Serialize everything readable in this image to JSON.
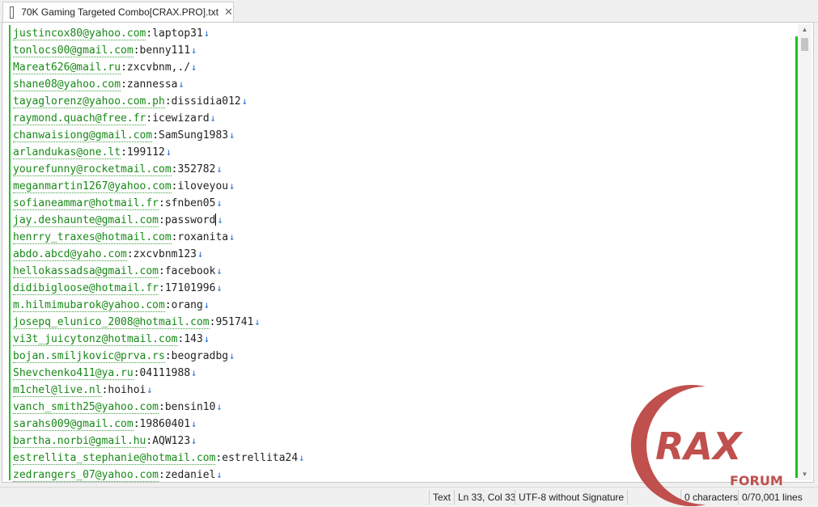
{
  "tab": {
    "title": "70K Gaming Targeted Combo[CRAX.PRO].txt",
    "close_glyph": "✕",
    "icon": "text-file-icon"
  },
  "editor": {
    "newline_glyph": "↓",
    "lines": [
      {
        "email": "justincox80@yahoo.com",
        "rest": ":laptop31",
        "nl": true
      },
      {
        "email": "tonlocs00@gmail.com",
        "rest": ":benny111",
        "nl": true
      },
      {
        "email": "Mareat626@mail.ru",
        "rest": ":zxcvbnm,./",
        "nl": true
      },
      {
        "email": "shane08@yahoo.com",
        "rest": ":zannessa",
        "nl": true
      },
      {
        "email": "tayaglorenz@yahoo.com.ph",
        "rest": ":dissidia012",
        "nl": true
      },
      {
        "email": "raymond.quach@free.fr",
        "rest": ":icewizard",
        "nl": true
      },
      {
        "email": "chanwaisiong@gmail.com",
        "rest": ":SamSung1983",
        "nl": true
      },
      {
        "email": "arlandukas@one.lt",
        "rest": ":199112",
        "nl": true
      },
      {
        "email": "yourefunny@rocketmail.com",
        "rest": ":352782",
        "nl": true
      },
      {
        "email": "meganmartin1267@yahoo.com",
        "rest": ":iloveyou",
        "nl": true
      },
      {
        "email": "sofianeammar@hotmail.fr",
        "rest": ":sfnben05",
        "nl": true
      },
      {
        "email": "jay.deshaunte@gmail.com",
        "rest": ":password",
        "nl": true,
        "caret": true
      },
      {
        "email": "henrry_traxes@hotmail.com",
        "rest": ":roxanita",
        "nl": true
      },
      {
        "email": "abdo.abcd@yaho.com",
        "rest": ":zxcvbnm123",
        "nl": true
      },
      {
        "email": "hellokassadsa@gmail.com",
        "rest": ":facebook",
        "nl": true
      },
      {
        "email": "didibigloose@hotmail.fr",
        "rest": ":17101996",
        "nl": true
      },
      {
        "email": "m.hilmimubarok@yahoo.com",
        "rest": ":orang",
        "nl": true
      },
      {
        "email": "josepq_elunico_2008@hotmail.com",
        "rest": ":951741",
        "nl": true
      },
      {
        "email": "vi3t_juicytonz@hotmail.com",
        "rest": ":143",
        "nl": true
      },
      {
        "email": "bojan.smiljkovic@prva.rs",
        "rest": ":beogradbg",
        "nl": true
      },
      {
        "email": "Shevchenko411@ya.ru",
        "rest": ":04111988",
        "nl": true
      },
      {
        "email": "m1chel@live.nl",
        "rest": ":hoihoi",
        "nl": true
      },
      {
        "email": "vanch_smith25@yahoo.com",
        "rest": ":bensin10",
        "nl": true
      },
      {
        "email": "sarahs009@gmail.com",
        "rest": ":19860401",
        "nl": true
      },
      {
        "email": "bartha.norbi@gmail.hu",
        "rest": ":AQW123",
        "nl": true
      },
      {
        "email": "estrellita_stephanie@hotmail.com",
        "rest": ":estrellita24",
        "nl": true
      },
      {
        "email": "zedrangers_07@yahoo.com",
        "rest": ":zedaniel",
        "nl": true
      }
    ]
  },
  "status": {
    "mode": "Text",
    "position": "Ln 33, Col 33",
    "encoding": "UTF-8 without Signature",
    "selection": "0 characters",
    "lines": "0/70,001 lines"
  },
  "watermark": {
    "text1": "RAX",
    "text2": "FORUM"
  },
  "colors": {
    "email": "#188918",
    "margin_bar": "#20c020",
    "newline": "#1f6fd1",
    "logo": "#c0504d"
  }
}
